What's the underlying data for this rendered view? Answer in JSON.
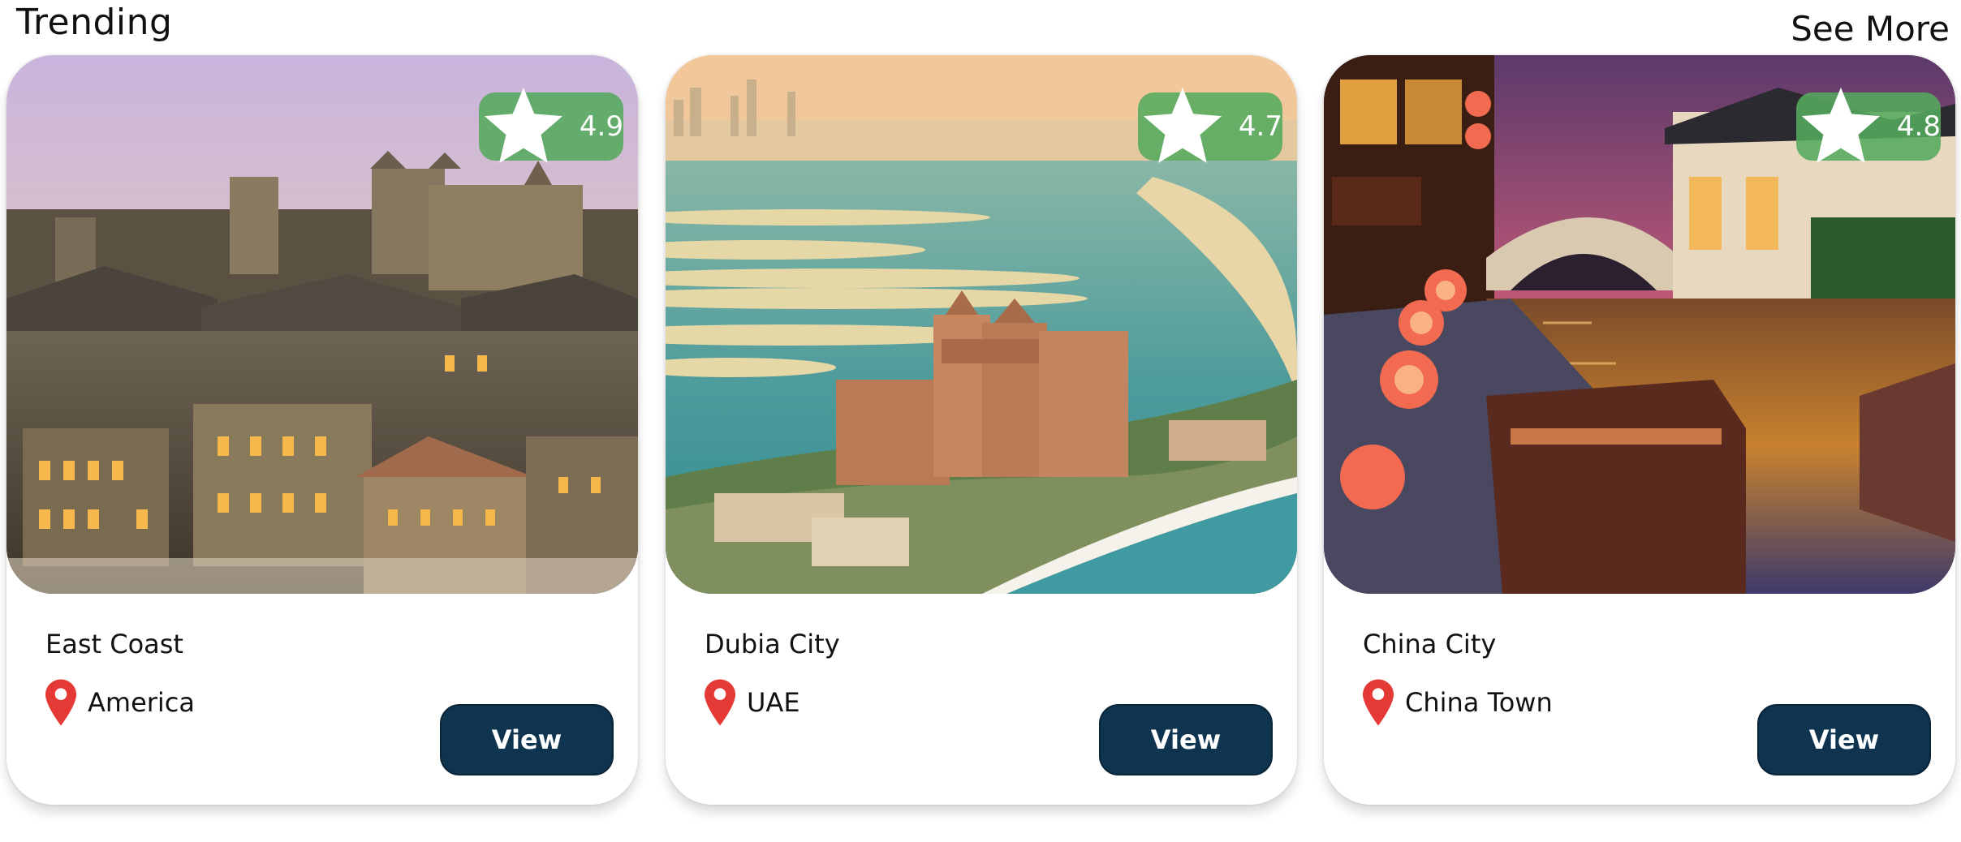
{
  "section": {
    "title": "Trending",
    "see_more_label": "See More"
  },
  "icons": {
    "rating": "star-icon",
    "location": "map-pin-icon"
  },
  "colors": {
    "rating_badge": "#54aa5c",
    "view_button": "#0f3450",
    "pin": "#e53935"
  },
  "cards": [
    {
      "name": "East Coast",
      "location": "America",
      "rating": "4.9",
      "button_label": "View"
    },
    {
      "name": "Dubia City",
      "location": "UAE",
      "rating": "4.7",
      "button_label": "View"
    },
    {
      "name": "China City",
      "location": "China Town",
      "rating": "4.8",
      "button_label": "View"
    }
  ]
}
